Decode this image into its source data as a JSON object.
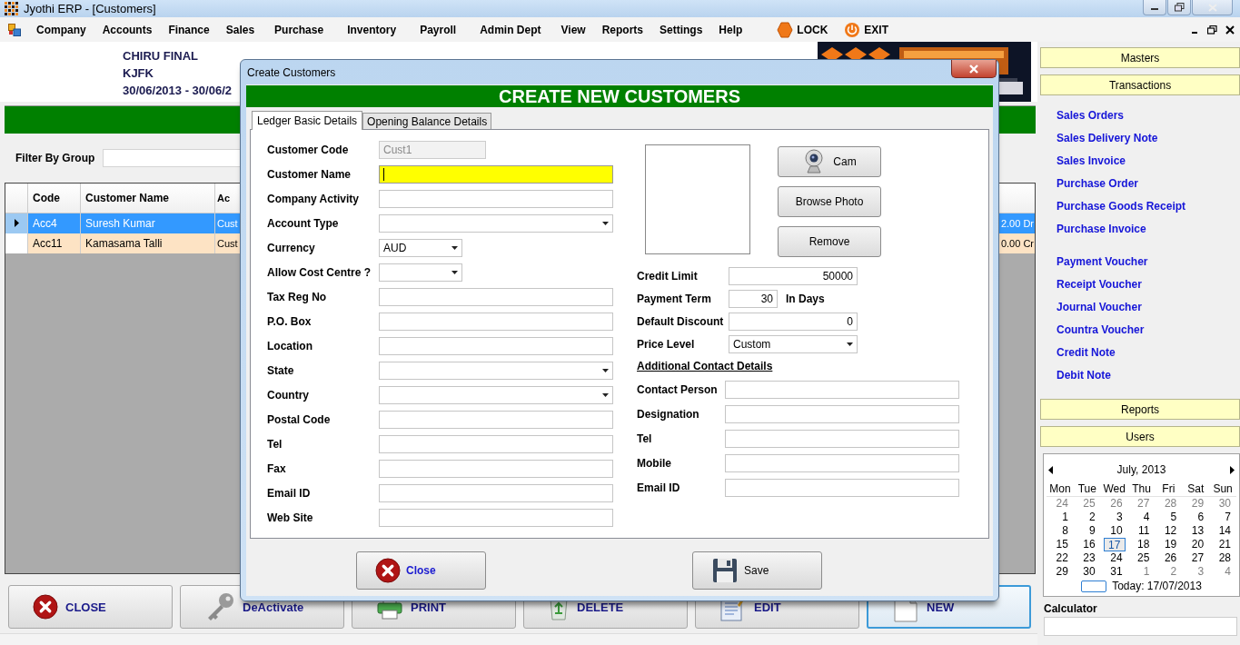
{
  "window": {
    "title": "Jyothi ERP - [Customers]"
  },
  "menu": [
    {
      "label": "Company",
      "kind": "text"
    },
    {
      "label": "Accounts",
      "kind": "text"
    },
    {
      "label": "Finance",
      "kind": "text"
    },
    {
      "label": "Sales",
      "kind": "text"
    },
    {
      "label": "Purchase",
      "kind": "text"
    },
    {
      "label": "Inventory",
      "kind": "text"
    },
    {
      "label": "Payroll",
      "kind": "text"
    },
    {
      "label": "Admin Dept",
      "kind": "text"
    },
    {
      "label": "View",
      "kind": "text"
    },
    {
      "label": "Reports",
      "kind": "text"
    },
    {
      "label": "Settings",
      "kind": "text"
    },
    {
      "label": "Help",
      "kind": "text"
    },
    {
      "label": "LOCK",
      "kind": "lock"
    },
    {
      "label": "EXIT",
      "kind": "exit"
    }
  ],
  "company": {
    "lines": [
      "CHIRU FINAL",
      "KJFK",
      "30/06/2013 - 30/06/2"
    ]
  },
  "filter": {
    "label": "Filter By Group"
  },
  "grid": {
    "columns": [
      "Code",
      "Customer Name",
      "Ac"
    ],
    "rows": [
      {
        "cells": [
          "Acc4",
          "Suresh Kumar",
          "Cust"
        ],
        "balance": "2.00 Dr",
        "selected": true
      },
      {
        "cells": [
          "Acc11",
          "Kamasama Talli",
          "Cust"
        ],
        "balance": "0.00 Cr",
        "selected": false
      }
    ]
  },
  "actions": [
    {
      "label": "CLOSE",
      "kind": "close",
      "focused": false
    },
    {
      "label": "DeActivate",
      "kind": "key",
      "focused": false
    },
    {
      "label": "PRINT",
      "kind": "print",
      "focused": false
    },
    {
      "label": "DELETE",
      "kind": "recycle",
      "focused": false
    },
    {
      "label": "EDIT",
      "kind": "edit",
      "focused": false
    },
    {
      "label": "NEW",
      "kind": "new",
      "focused": true
    }
  ],
  "side_panel": {
    "top_buttons": [
      "Masters",
      "Transactions"
    ],
    "link_groups": [
      [
        "Sales Orders",
        "Sales Delivery Note",
        "Sales Invoice",
        "Purchase Order",
        "Purchase Goods Receipt",
        "Purchase Invoice"
      ],
      [
        "Payment Voucher",
        "Receipt Voucher",
        "Journal Voucher",
        "Countra Voucher",
        "Credit Note",
        "Debit Note"
      ]
    ],
    "bottom_buttons": [
      "Reports",
      "Users"
    ]
  },
  "calendar": {
    "month": "July, 2013",
    "weekdays": [
      "Mon",
      "Tue",
      "Wed",
      "Thu",
      "Fri",
      "Sat",
      "Sun"
    ],
    "weeks": [
      [
        {
          "day": "24",
          "other_month": true,
          "selected": false
        },
        {
          "day": "25",
          "other_month": true,
          "selected": false
        },
        {
          "day": "26",
          "other_month": true,
          "selected": false
        },
        {
          "day": "27",
          "other_month": true,
          "selected": false
        },
        {
          "day": "28",
          "other_month": true,
          "selected": false
        },
        {
          "day": "29",
          "other_month": true,
          "selected": false
        },
        {
          "day": "30",
          "other_month": true,
          "selected": false
        }
      ],
      [
        {
          "day": "1",
          "other_month": false,
          "selected": false
        },
        {
          "day": "2",
          "other_month": false,
          "selected": false
        },
        {
          "day": "3",
          "other_month": false,
          "selected": false
        },
        {
          "day": "4",
          "other_month": false,
          "selected": false
        },
        {
          "day": "5",
          "other_month": false,
          "selected": false
        },
        {
          "day": "6",
          "other_month": false,
          "selected": false
        },
        {
          "day": "7",
          "other_month": false,
          "selected": false
        }
      ],
      [
        {
          "day": "8",
          "other_month": false,
          "selected": false
        },
        {
          "day": "9",
          "other_month": false,
          "selected": false
        },
        {
          "day": "10",
          "other_month": false,
          "selected": false
        },
        {
          "day": "11",
          "other_month": false,
          "selected": false
        },
        {
          "day": "12",
          "other_month": false,
          "selected": false
        },
        {
          "day": "13",
          "other_month": false,
          "selected": false
        },
        {
          "day": "14",
          "other_month": false,
          "selected": false
        }
      ],
      [
        {
          "day": "15",
          "other_month": false,
          "selected": false
        },
        {
          "day": "16",
          "other_month": false,
          "selected": false
        },
        {
          "day": "17",
          "other_month": false,
          "selected": true
        },
        {
          "day": "18",
          "other_month": false,
          "selected": false
        },
        {
          "day": "19",
          "other_month": false,
          "selected": false
        },
        {
          "day": "20",
          "other_month": false,
          "selected": false
        },
        {
          "day": "21",
          "other_month": false,
          "selected": false
        }
      ],
      [
        {
          "day": "22",
          "other_month": false,
          "selected": false
        },
        {
          "day": "23",
          "other_month": false,
          "selected": false
        },
        {
          "day": "24",
          "other_month": false,
          "selected": false
        },
        {
          "day": "25",
          "other_month": false,
          "selected": false
        },
        {
          "day": "26",
          "other_month": false,
          "selected": false
        },
        {
          "day": "27",
          "other_month": false,
          "selected": false
        },
        {
          "day": "28",
          "other_month": false,
          "selected": false
        }
      ],
      [
        {
          "day": "29",
          "other_month": false,
          "selected": false
        },
        {
          "day": "30",
          "other_month": false,
          "selected": false
        },
        {
          "day": "31",
          "other_month": false,
          "selected": false
        },
        {
          "day": "1",
          "other_month": true,
          "selected": false
        },
        {
          "day": "2",
          "other_month": true,
          "selected": false
        },
        {
          "day": "3",
          "other_month": true,
          "selected": false
        },
        {
          "day": "4",
          "other_month": true,
          "selected": false
        }
      ]
    ],
    "today": "Today: 17/07/2013"
  },
  "calculator": {
    "label": "Calculator"
  },
  "dialog": {
    "title": "Create Customers",
    "heading": "CREATE NEW CUSTOMERS",
    "tabs": [
      {
        "label": "Ledger Basic Details",
        "selected": true
      },
      {
        "label": "Opening Balance Details",
        "selected": false
      }
    ],
    "left_fields": [
      {
        "label": "Customer Code",
        "kind": "short-text",
        "value": "Cust1",
        "disabled": true,
        "focused": false
      },
      {
        "label": "Customer Name",
        "kind": "text",
        "disabled": false,
        "focused": true
      },
      {
        "label": "Company Activity",
        "kind": "text",
        "disabled": false,
        "focused": false
      },
      {
        "label": "Account Type",
        "kind": "combo",
        "disabled": false,
        "focused": false
      },
      {
        "label": "Currency",
        "kind": "short-combo",
        "value": "AUD",
        "disabled": false,
        "focused": false
      },
      {
        "label": "Allow Cost Centre ?",
        "kind": "short-combo",
        "disabled": false,
        "focused": false
      },
      {
        "label": "Tax Reg No",
        "kind": "text",
        "disabled": false,
        "focused": false
      },
      {
        "label": "P.O. Box",
        "kind": "text",
        "disabled": false,
        "focused": false
      },
      {
        "label": "Location",
        "kind": "text",
        "disabled": false,
        "focused": false
      },
      {
        "label": "State",
        "kind": "combo",
        "disabled": false,
        "focused": false
      },
      {
        "label": "Country",
        "kind": "combo",
        "disabled": false,
        "focused": false
      },
      {
        "label": "Postal Code",
        "kind": "text",
        "disabled": false,
        "focused": false
      },
      {
        "label": "Tel",
        "kind": "text",
        "disabled": false,
        "focused": false
      },
      {
        "label": "Fax",
        "kind": "text",
        "disabled": false,
        "focused": false
      },
      {
        "label": "Email ID",
        "kind": "text",
        "disabled": false,
        "focused": false
      },
      {
        "label": "Web Site",
        "kind": "text",
        "disabled": false,
        "focused": false
      }
    ],
    "photo_buttons": [
      {
        "label": "Cam",
        "kind": "cam"
      },
      {
        "label": "Browse Photo",
        "kind": "plain"
      },
      {
        "label": "Remove",
        "kind": "plain"
      }
    ],
    "terms": [
      {
        "label": "Credit Limit",
        "kind": "number",
        "value": "50000"
      },
      {
        "label": "Payment Term",
        "kind": "days",
        "value": "30",
        "suffix": "In Days"
      },
      {
        "label": "Default Discount",
        "kind": "number",
        "value": "0"
      },
      {
        "label": "Price Level",
        "kind": "combo",
        "value": "Custom"
      }
    ],
    "contact_heading": "Additional Contact Details",
    "contact_fields": [
      "Contact Person",
      "Designation",
      "Tel",
      "Mobile",
      "Email ID"
    ],
    "buttons": [
      {
        "label": "Close",
        "kind": "close"
      },
      {
        "label": "Save",
        "kind": "save"
      }
    ]
  }
}
